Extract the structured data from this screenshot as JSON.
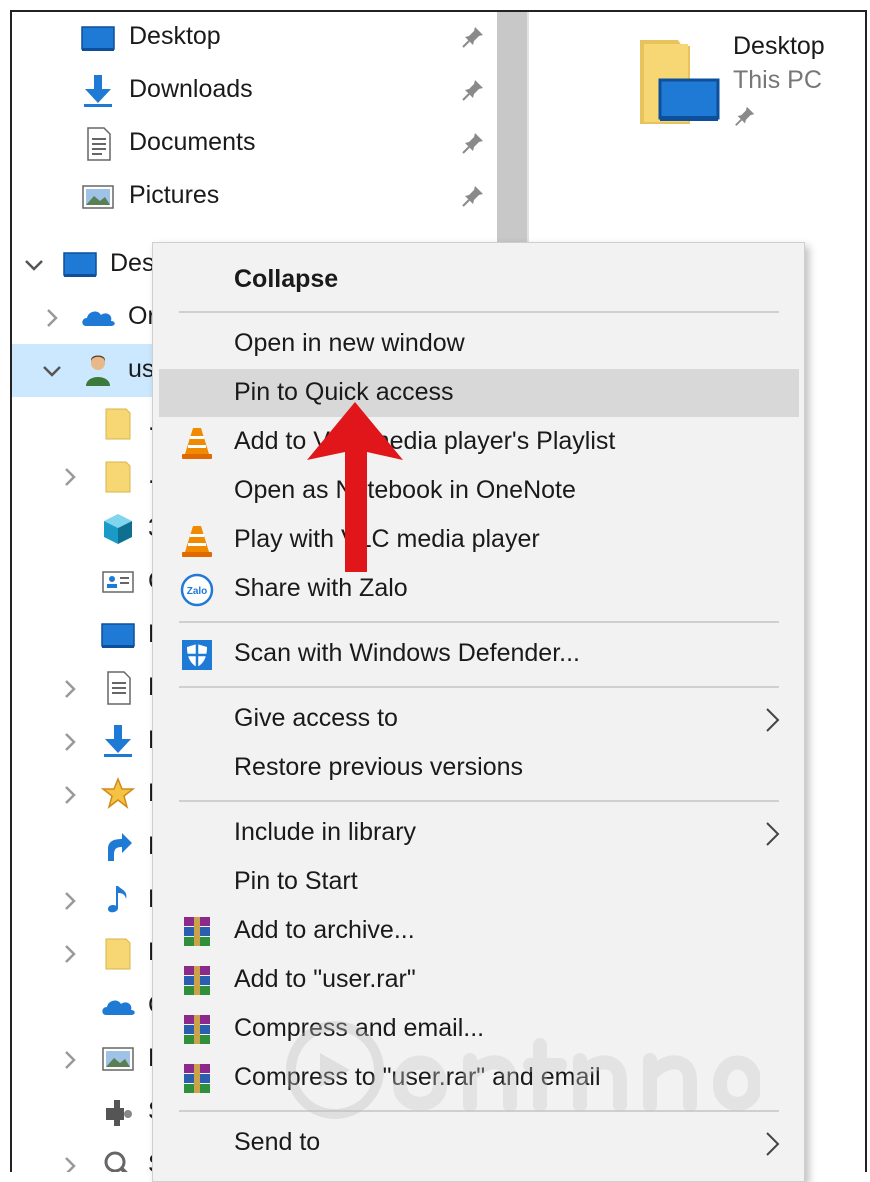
{
  "quick_access": [
    {
      "label": "Desktop",
      "icon": "desktop-icon"
    },
    {
      "label": "Downloads",
      "icon": "downloads-icon"
    },
    {
      "label": "Documents",
      "icon": "documents-icon"
    },
    {
      "label": "Pictures",
      "icon": "pictures-icon"
    }
  ],
  "tree": [
    {
      "label": "Des",
      "icon": "desktop-icon",
      "chevron": "down"
    },
    {
      "label": "Or",
      "icon": "onedrive-icon",
      "chevron": "right"
    },
    {
      "label": "us",
      "icon": "user-icon",
      "chevron": "down",
      "selected": true
    },
    {
      "label": ".",
      "icon": "folder-icon",
      "chevron": "none"
    },
    {
      "label": ".",
      "icon": "folder-icon",
      "chevron": "right"
    },
    {
      "label": "3",
      "icon": "3d-objects-icon",
      "chevron": "none"
    },
    {
      "label": "C",
      "icon": "contacts-icon",
      "chevron": "none"
    },
    {
      "label": "D",
      "icon": "desktop-icon",
      "chevron": "none"
    },
    {
      "label": "D",
      "icon": "documents-icon",
      "chevron": "right"
    },
    {
      "label": "D",
      "icon": "downloads-icon",
      "chevron": "right"
    },
    {
      "label": "F",
      "icon": "favorites-star-icon",
      "chevron": "right"
    },
    {
      "label": "L",
      "icon": "links-icon",
      "chevron": "none"
    },
    {
      "label": "M",
      "icon": "music-icon",
      "chevron": "right"
    },
    {
      "label": "N",
      "icon": "folder-icon",
      "chevron": "right"
    },
    {
      "label": "C",
      "icon": "onedrive-icon",
      "chevron": "none"
    },
    {
      "label": "P",
      "icon": "pictures-icon",
      "chevron": "right"
    },
    {
      "label": "S",
      "icon": "saved-games-icon",
      "chevron": "none"
    },
    {
      "label": "S",
      "icon": "searches-icon",
      "chevron": "right"
    }
  ],
  "content_tile": {
    "name": "Desktop",
    "sub": "This PC"
  },
  "menu": {
    "items": [
      {
        "label": "Collapse",
        "bold": true
      },
      {
        "label": "Open in new window"
      },
      {
        "label": "Pin to Quick access",
        "hover": true
      },
      {
        "label": "Add to VLC media player's Playlist",
        "icon": "vlc-icon"
      },
      {
        "label": "Open as Notebook in OneNote"
      },
      {
        "label": "Play with VLC media player",
        "icon": "vlc-icon"
      },
      {
        "label": "Share with Zalo",
        "icon": "zalo-icon"
      },
      {
        "label": "Scan with Windows Defender...",
        "icon": "windows-defender-icon"
      },
      {
        "label": "Give access to",
        "submenu": true
      },
      {
        "label": "Restore previous versions"
      },
      {
        "label": "Include in library",
        "submenu": true
      },
      {
        "label": "Pin to Start"
      },
      {
        "label": "Add to archive...",
        "icon": "winrar-icon"
      },
      {
        "label": "Add to \"user.rar\"",
        "icon": "winrar-icon"
      },
      {
        "label": "Compress and email...",
        "icon": "winrar-icon"
      },
      {
        "label": "Compress to \"user.rar\" and email",
        "icon": "winrar-icon"
      },
      {
        "label": "Send to",
        "submenu": true
      }
    ],
    "zalo_icon_text": "Zalo"
  },
  "colors": {
    "selection": "#cce8ff",
    "menu_bg": "#f2f2f2",
    "menu_hover": "#d8d8d8",
    "annotation_arrow": "#e0161b",
    "folder_yellow": "#f7d774",
    "windows_blue": "#1f7ad6"
  }
}
